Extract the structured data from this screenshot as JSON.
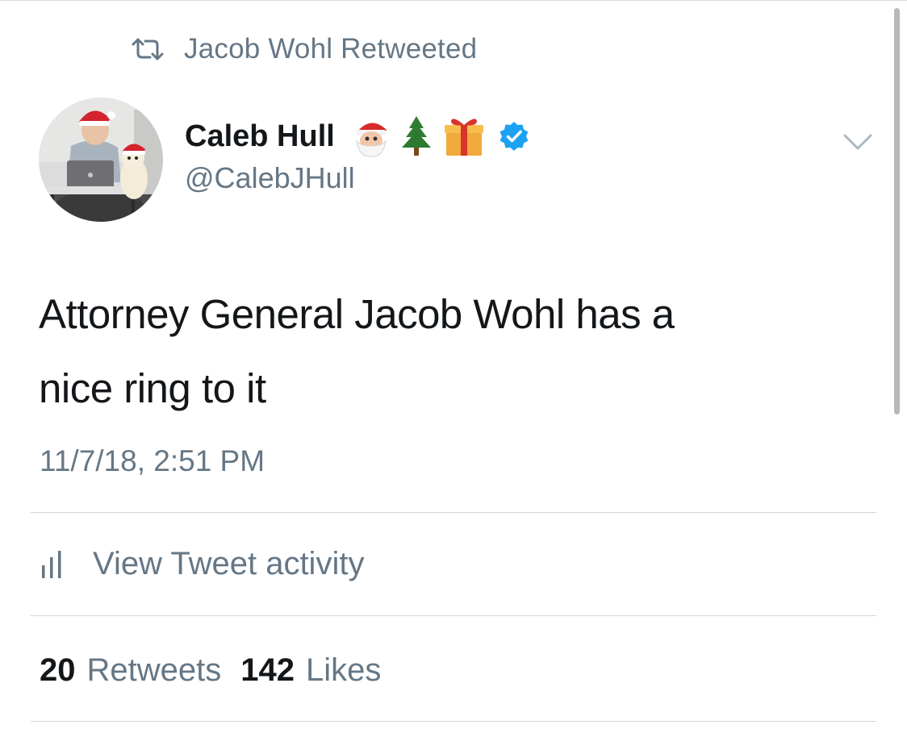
{
  "retweet_context": {
    "text": "Jacob Wohl Retweeted",
    "icon": "retweet-icon"
  },
  "author": {
    "display_name": "Caleb Hull",
    "handle": "@CalebJHull",
    "name_emojis": [
      "🎅",
      "🎄",
      "🎁"
    ],
    "verified": true
  },
  "tweet": {
    "line1": "Attorney General Jacob Wohl has a",
    "line2": "nice ring to it",
    "timestamp": "11/7/18, 2:51 PM"
  },
  "actions": {
    "view_activity": "View Tweet activity",
    "activity_icon": "bar-chart-icon",
    "caret_icon": "chevron-down-icon"
  },
  "stats": {
    "retweets_count": "20",
    "retweets_label": "Retweets",
    "likes_count": "142",
    "likes_label": "Likes"
  },
  "colors": {
    "secondary_text": "#657786",
    "primary_text": "#14171a",
    "verified_blue": "#1da1f2"
  }
}
